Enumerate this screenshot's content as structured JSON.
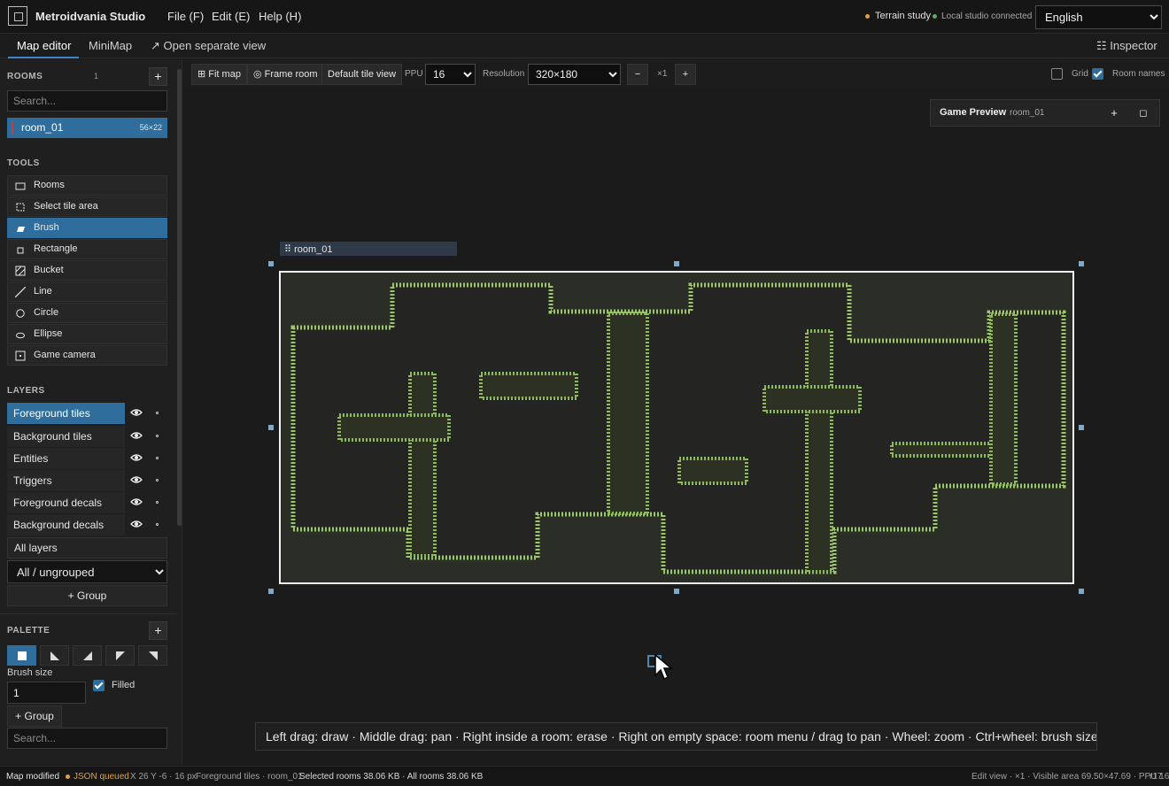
{
  "app": {
    "title": "Metroidvania Studio"
  },
  "menu": {
    "file": "File (F)",
    "edit": "Edit (E)",
    "help": "Help (H)"
  },
  "status_top": {
    "project": "Terrain study",
    "project_dot_color": "#e0a040",
    "connection": "Local studio connected",
    "connection_dot_color": "#5aa86a"
  },
  "language": {
    "selected": "English"
  },
  "tabs": {
    "map_editor": "Map editor",
    "minimap": "MiniMap",
    "open_separate": "↗ Open separate view",
    "inspector": "☷ Inspector"
  },
  "rooms": {
    "heading": "ROOMS",
    "count": "1",
    "add_label": "+",
    "search_placeholder": "Search...",
    "items": [
      {
        "name": "room_01",
        "size": "56×22"
      }
    ]
  },
  "tools": {
    "heading": "TOOLS",
    "items": [
      {
        "label": "Rooms",
        "icon": "room-rect-icon"
      },
      {
        "label": "Select tile area",
        "icon": "select-area-icon"
      },
      {
        "label": "Brush",
        "icon": "brush-icon",
        "active": true
      },
      {
        "label": "Rectangle",
        "icon": "rectangle-icon"
      },
      {
        "label": "Bucket",
        "icon": "bucket-icon"
      },
      {
        "label": "Line",
        "icon": "line-icon"
      },
      {
        "label": "Circle",
        "icon": "circle-icon"
      },
      {
        "label": "Ellipse",
        "icon": "ellipse-icon"
      },
      {
        "label": "Game camera",
        "icon": "camera-icon"
      }
    ]
  },
  "layers": {
    "heading": "LAYERS",
    "items": [
      {
        "name": "Foreground tiles",
        "active": true
      },
      {
        "name": "Background tiles"
      },
      {
        "name": "Entities"
      },
      {
        "name": "Triggers"
      },
      {
        "name": "Foreground decals"
      },
      {
        "name": "Background decals"
      }
    ],
    "all_layers": "All layers",
    "group_filter": "All / ungrouped",
    "add_group": "+ Group"
  },
  "palette": {
    "heading": "PALETTE",
    "add_label": "+",
    "shapes": [
      "square-tile-icon",
      "slope-bottom-left-icon",
      "slope-bottom-right-icon",
      "slope-top-left-icon",
      "slope-top-right-icon"
    ],
    "brush_size_label": "Brush size",
    "brush_size": "1",
    "filled_label": "Filled",
    "filled": true,
    "add_group": "+ Group",
    "search_placeholder": "Search..."
  },
  "toolbar": {
    "fit_map": "⊞ Fit map",
    "frame_room": "◎ Frame room",
    "default_tile_view": "Default tile view",
    "ppu_label": "PPU",
    "ppu": "16",
    "resolution_label": "Resolution",
    "resolution": "320×180",
    "zoom_out": "−",
    "zoom": "×1",
    "zoom_in": "+",
    "grid_label": "Grid",
    "grid": false,
    "room_names_label": "Room names",
    "room_names": true
  },
  "preview": {
    "title": "Game Preview",
    "room": "room_01",
    "add": "+",
    "maximize": "◻"
  },
  "canvas": {
    "room_label": "⠿ room_01",
    "terrain_color": "#8dbb5a",
    "background_color": "#262725",
    "hint": "Left drag: draw · Middle drag: pan · Right inside a room: erase · Right on empty space: room menu / drag to pan · Wheel: zoom · Ctrl+wheel: brush size"
  },
  "statusbar": {
    "modified": "Map modified",
    "json_state": "JSON queued",
    "json_dot_color": "#e0a040",
    "cursor": "X 26 Y -6 · 16 px",
    "layer": "Foreground tiles · room_01",
    "sizes": "Selected rooms 38.06 KB · All rooms 38.06 KB",
    "view": "Edit view · ×1 · Visible area 69.50×47.69 · PPU 16",
    "revision": "r17"
  }
}
